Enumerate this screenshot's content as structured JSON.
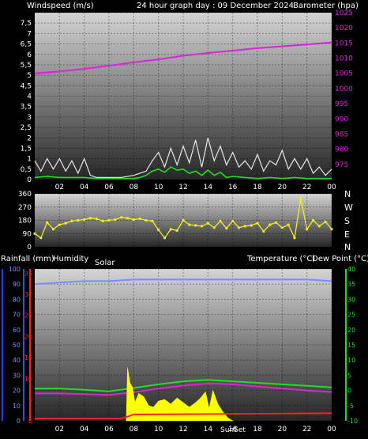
{
  "header": {
    "left_label": "Windspeed (m/s)",
    "title": "24 hour graph day : 09 December 2024",
    "right_label": "Barometer (hpa)"
  },
  "labels": {
    "direction_letters": [
      "N",
      "W",
      "S",
      "E",
      "N"
    ],
    "rainfall": "Rainfall (mm)",
    "humidity": "Humidity",
    "solar": "Solar",
    "temperature": "Temperature (°C)",
    "dewpoint": "Dew Point (°C)",
    "sunrise": "Sunrise",
    "sunset": "SunSet"
  },
  "colors": {
    "wind_gust": "#e8e8e8",
    "wind_avg": "#22dd22",
    "barometer": "#dd22dd",
    "direction": "#eeee22",
    "humidity": "#7c8cff",
    "temperature": "#22dd22",
    "dewpoint": "#dd22dd",
    "solar": "#ffff00",
    "rain": "#ff2020"
  },
  "chart_data": [
    {
      "type": "line",
      "title": "24 hour graph day : 09 December 2024",
      "ylabel": "Windspeed (m/s)",
      "ylim": [
        0,
        8
      ],
      "y_ticks": [
        "0",
        "0,5",
        "1",
        "1,5",
        "2",
        "2,5",
        "3",
        "3,5",
        "4",
        "4,5",
        "5",
        "5,5",
        "6",
        "6,5",
        "7",
        "7,5"
      ],
      "y2label": "Barometer (hpa)",
      "y2lim": [
        970,
        1025
      ],
      "y2_ticks": [
        "975",
        "980",
        "985",
        "990",
        "995",
        "1000",
        "1005",
        "1010",
        "1015",
        "1020",
        "1025"
      ],
      "x_ticks": [
        "02",
        "04",
        "06",
        "08",
        "10",
        "12",
        "14",
        "16",
        "18",
        "20",
        "22",
        "00"
      ],
      "series": [
        {
          "name": "Barometer (hpa)",
          "axis": "right",
          "x": [
            0,
            2,
            4,
            6,
            8,
            10,
            12,
            14,
            16,
            18,
            20,
            22,
            24
          ],
          "y": [
            1005.0,
            1005.6,
            1006.5,
            1007.5,
            1008.6,
            1009.6,
            1010.8,
            1011.7,
            1012.5,
            1013.3,
            1013.9,
            1014.5,
            1015.2
          ]
        },
        {
          "name": "Windspeed (m/s)",
          "axis": "left",
          "style": "gust",
          "x": [
            0,
            0.5,
            1,
            1.5,
            2,
            2.5,
            3,
            3.5,
            4,
            4.5,
            5,
            6,
            7,
            8,
            8.5,
            9,
            9.5,
            10,
            10.5,
            11,
            11.5,
            12,
            12.5,
            13,
            13.5,
            14,
            14.5,
            15,
            15.5,
            16,
            16.5,
            17,
            17.5,
            18,
            18.5,
            19,
            19.5,
            20,
            20.5,
            21,
            21.5,
            22,
            22.5,
            23,
            23.5,
            24
          ],
          "y": [
            0.9,
            0.4,
            1.0,
            0.5,
            1.0,
            0.4,
            0.9,
            0.3,
            1.0,
            0.2,
            0.1,
            0.1,
            0.1,
            0.2,
            0.3,
            0.4,
            0.9,
            1.3,
            0.6,
            1.5,
            0.7,
            1.6,
            0.8,
            1.9,
            0.6,
            2.0,
            0.9,
            1.6,
            0.7,
            1.3,
            0.6,
            0.9,
            0.5,
            1.2,
            0.4,
            0.9,
            0.7,
            1.4,
            0.5,
            1.0,
            0.5,
            1.0,
            0.3,
            0.6,
            0.2,
            0.5
          ]
        },
        {
          "name": "Windspeed avg",
          "axis": "left",
          "style": "avg",
          "x": [
            0,
            1,
            2,
            3,
            4,
            5,
            6,
            7,
            8,
            8.5,
            9,
            9.5,
            10,
            10.5,
            11,
            11.5,
            12,
            12.5,
            13,
            13.5,
            14,
            14.5,
            15,
            15.5,
            16,
            17,
            18,
            19,
            20,
            21,
            22,
            23,
            24
          ],
          "y": [
            0.1,
            0.15,
            0.1,
            0.1,
            0.1,
            0.05,
            0.05,
            0.05,
            0.05,
            0.1,
            0.2,
            0.4,
            0.5,
            0.35,
            0.6,
            0.45,
            0.5,
            0.3,
            0.4,
            0.2,
            0.45,
            0.2,
            0.35,
            0.1,
            0.15,
            0.1,
            0.05,
            0.1,
            0.05,
            0.1,
            0.05,
            0.05,
            0.05
          ]
        }
      ]
    },
    {
      "type": "scatter",
      "ylabel": "Wind direction",
      "ylim": [
        0,
        360
      ],
      "y_ticks": [
        "0",
        "90",
        "180",
        "270",
        "360"
      ],
      "x_ticks": [
        "02",
        "04",
        "06",
        "08",
        "10",
        "12",
        "14",
        "16",
        "18",
        "20",
        "22",
        "00"
      ],
      "series": [
        {
          "name": "Wind direction",
          "x": [
            0,
            0.5,
            1,
            1.5,
            2,
            2.5,
            3,
            3.5,
            4,
            4.5,
            5,
            5.5,
            6,
            6.5,
            7,
            7.5,
            8,
            8.5,
            9,
            9.5,
            10,
            10.5,
            11,
            11.5,
            12,
            12.5,
            13,
            13.5,
            14,
            14.5,
            15,
            15.5,
            16,
            16.5,
            17,
            17.5,
            18,
            18.5,
            19,
            19.5,
            20,
            20.5,
            21,
            21.5,
            22,
            22.5,
            23,
            23.5,
            24
          ],
          "y": [
            90,
            60,
            165,
            120,
            150,
            160,
            175,
            180,
            185,
            195,
            190,
            175,
            180,
            185,
            200,
            195,
            185,
            190,
            180,
            175,
            115,
            60,
            120,
            110,
            180,
            150,
            145,
            140,
            160,
            130,
            175,
            125,
            175,
            130,
            140,
            145,
            160,
            105,
            150,
            165,
            130,
            150,
            60,
            330,
            120,
            180,
            140,
            170,
            120
          ]
        }
      ]
    },
    {
      "type": "line",
      "ylabel": "Humidity",
      "ylim": [
        0,
        100
      ],
      "y_ticks": [
        "0",
        "10",
        "20",
        "30",
        "40",
        "50",
        "60",
        "70",
        "80",
        "90",
        "100"
      ],
      "y_rain_ticks": [
        "0",
        "5",
        "10",
        "15",
        "20",
        "25",
        "30",
        "35"
      ],
      "y2label": "Temperature (°C)",
      "y2lim": [
        -10,
        40
      ],
      "y2_ticks": [
        "-10",
        "-5",
        "0",
        "5",
        "10",
        "15",
        "20",
        "25",
        "30",
        "35",
        "40"
      ],
      "x_ticks": [
        "02",
        "04",
        "06",
        "08",
        "10",
        "12",
        "14",
        "16",
        "18",
        "20",
        "22",
        "00"
      ],
      "series": [
        {
          "name": "Humidity",
          "axis": "left",
          "x": [
            0,
            2,
            4,
            6,
            8,
            10,
            12,
            14,
            16,
            18,
            20,
            22,
            24
          ],
          "y": [
            90,
            91,
            92,
            92,
            93,
            93,
            93,
            93,
            93,
            93,
            93,
            93,
            92
          ]
        },
        {
          "name": "Temperature (°C)",
          "axis": "right",
          "x": [
            0,
            2,
            4,
            6,
            8,
            10,
            12,
            14,
            16,
            18,
            20,
            22,
            24
          ],
          "y": [
            0.6,
            0.6,
            0.2,
            -0.3,
            0.8,
            2.0,
            3.0,
            3.5,
            3.0,
            2.5,
            2.0,
            1.5,
            1.0
          ]
        },
        {
          "name": "Dew Point (°C)",
          "axis": "right",
          "x": [
            0,
            2,
            4,
            6,
            8,
            10,
            12,
            14,
            16,
            18,
            20,
            22,
            24
          ],
          "y": [
            -1.0,
            -1.0,
            -1.2,
            -1.5,
            -0.6,
            0.6,
            1.6,
            2.3,
            2.0,
            1.3,
            0.6,
            0.0,
            -0.5
          ]
        },
        {
          "name": "Solar",
          "axis": "left",
          "style": "area",
          "x": [
            7.4,
            7.5,
            7.7,
            7.9,
            8.1,
            8.4,
            8.8,
            9.2,
            9.6,
            10,
            10.5,
            11,
            11.5,
            12,
            12.5,
            13,
            13.4,
            13.8,
            14.1,
            14.4,
            14.8,
            15.2,
            15.6,
            16
          ],
          "y": [
            0,
            35,
            25,
            22,
            12,
            18,
            16,
            10,
            9,
            13,
            14,
            11,
            15,
            12,
            9,
            12,
            15,
            19,
            8,
            20,
            11,
            6,
            2,
            0
          ]
        },
        {
          "name": "Rainfall (mm)",
          "axis": "left",
          "style": "line",
          "x": [
            0,
            7,
            8,
            24
          ],
          "y": [
            0.5,
            0.5,
            1.5,
            1.8
          ]
        }
      ]
    }
  ]
}
